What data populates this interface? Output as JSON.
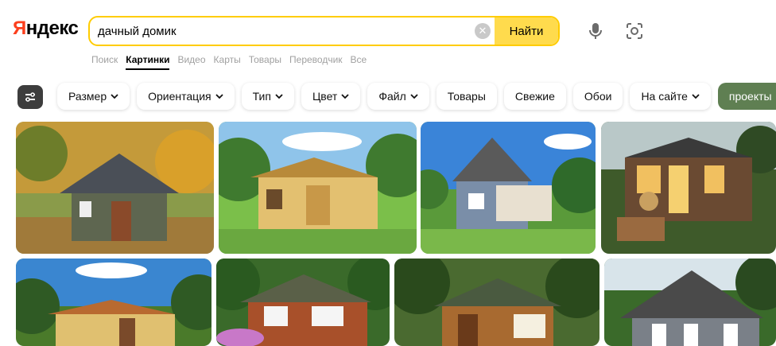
{
  "header": {
    "logo_first": "Я",
    "logo_rest": "ндекс",
    "search_value": "дачный домик",
    "find_label": "Найти"
  },
  "services": [
    "Поиск",
    "Картинки",
    "Видео",
    "Карты",
    "Товары",
    "Переводчик",
    "Все"
  ],
  "active_service": "Картинки",
  "filters": [
    {
      "label": "Размер",
      "dropdown": true
    },
    {
      "label": "Ориентация",
      "dropdown": true
    },
    {
      "label": "Тип",
      "dropdown": true
    },
    {
      "label": "Цвет",
      "dropdown": true
    },
    {
      "label": "Файл",
      "dropdown": true
    },
    {
      "label": "Товары",
      "dropdown": false
    },
    {
      "label": "Свежие",
      "dropdown": false
    },
    {
      "label": "Обои",
      "dropdown": false
    },
    {
      "label": "На сайте",
      "dropdown": true
    },
    {
      "label": "проекты",
      "dropdown": false,
      "highlighted": true
    }
  ],
  "icons": {
    "clear": "clear-icon",
    "mic": "microphone-icon",
    "lens": "camera-search-icon",
    "filters": "sliders-icon"
  },
  "colors": {
    "search_border": "#ffcc00",
    "find_button": "#ffdb4d",
    "logo_accent": "#fc3f1d",
    "chip_highlight": "#5f7f52"
  },
  "images": [
    {
      "description": "gray cabin autumn forest"
    },
    {
      "description": "yellow wooden house with terrace"
    },
    {
      "description": "gray cabin with porch"
    },
    {
      "description": "tiny house with lights at dusk"
    },
    {
      "description": "yellow cabin with sky"
    },
    {
      "description": "red wooden house green roof"
    },
    {
      "description": "wooden cabin in forest"
    },
    {
      "description": "white and gray cottage"
    }
  ]
}
